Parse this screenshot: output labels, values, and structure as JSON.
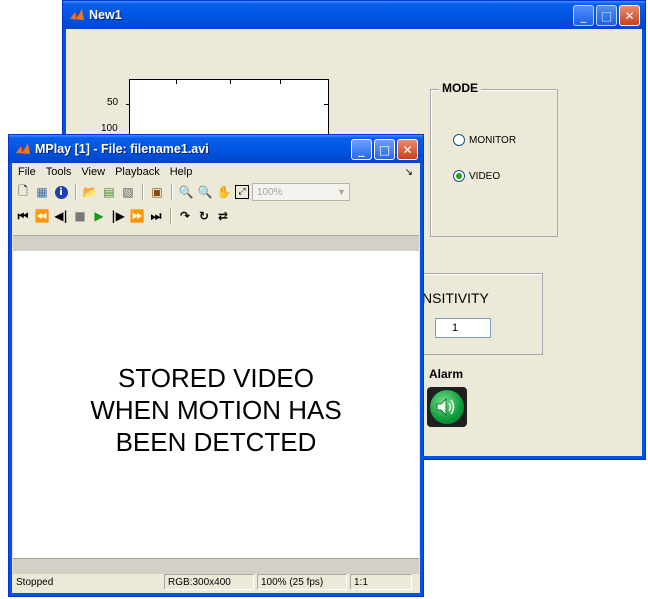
{
  "new1": {
    "title": "New1",
    "axes": {
      "yticks": [
        "50",
        "100"
      ]
    },
    "mode_panel": {
      "title": "MODE",
      "options": [
        {
          "label": "MONITOR",
          "selected": false
        },
        {
          "label": "VIDEO",
          "selected": true
        }
      ]
    },
    "sensitivity_panel": {
      "title": "NSITIVITY",
      "value": "1"
    },
    "alarm": {
      "label": "Alarm",
      "icon": "speaker-icon"
    }
  },
  "mplay": {
    "title": "MPlay [1] - File: filename1.avi",
    "menu": [
      "File",
      "Tools",
      "View",
      "Playback",
      "Help"
    ],
    "menu_overflow": "↘",
    "zoom": {
      "value": "100%"
    },
    "video_text": "STORED VIDEO\nWHEN MOTION HAS\nBEEN DETCTED",
    "status": {
      "state": "Stopped",
      "format": "RGB:300x400",
      "zoom_fps": "100% (25 fps)",
      "ratio": "1:1"
    }
  },
  "colors": {
    "titlebar": "#0054e3",
    "face": "#ece9d8",
    "alarm_green": "#0e9a3a"
  }
}
